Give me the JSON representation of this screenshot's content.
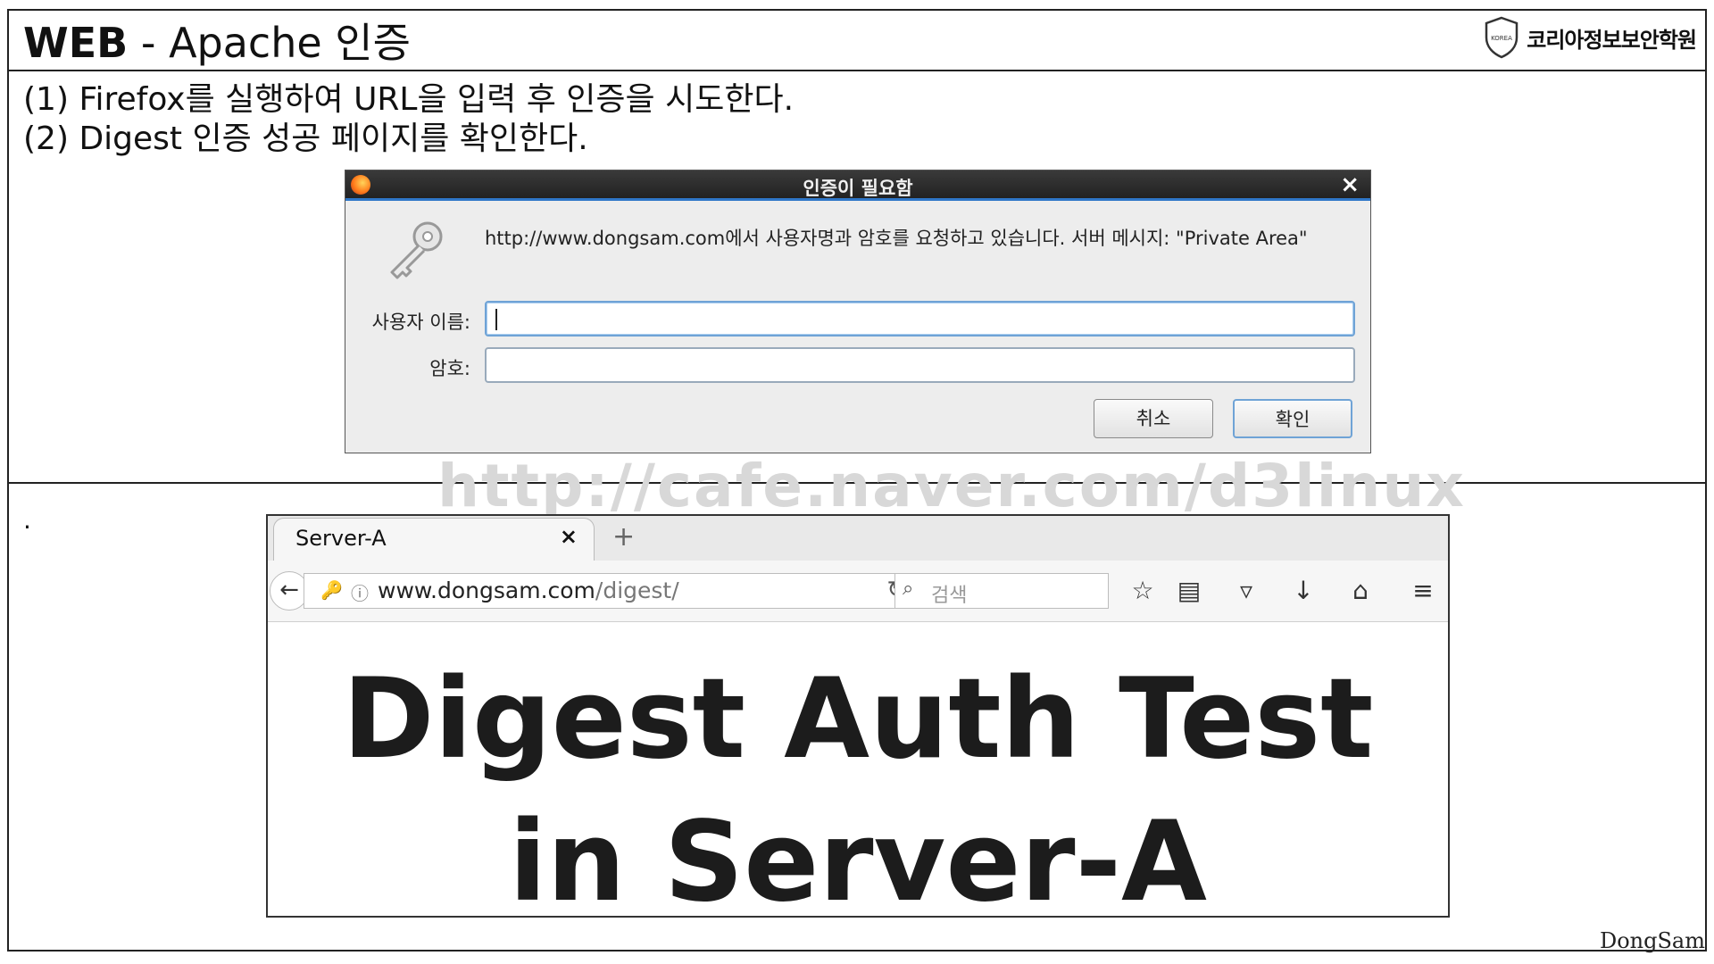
{
  "slide": {
    "title_bold": "WEB",
    "title_rest": " - Apache 인증",
    "logo_text": "코리아정보보안학원",
    "logo_badge": "KOREA",
    "steps": [
      "(1) Firefox를 실행하여 URL을 입력 후 인증을 시도한다.",
      "(2) Digest 인증 성공 페이지를 확인한다."
    ],
    "watermark": "http://cafe.naver.com/d3linux",
    "bullet_dot": ".",
    "footer": "DongSam"
  },
  "auth_dialog": {
    "title": "인증이 필요함",
    "close": "×",
    "message": "http://www.dongsam.com에서 사용자명과 암호를 요청하고 있습니다. 서버 메시지: \"Private Area\"",
    "username_label": "사용자 이름:",
    "username_value": "",
    "password_label": "암호:",
    "password_value": "",
    "cancel_label": "취소",
    "ok_label": "확인"
  },
  "browser": {
    "tab_title": "Server-A",
    "tab_close": "×",
    "new_tab": "+",
    "url_host": "www.dongsam.com",
    "url_path": "/digest/",
    "search_placeholder": "검색",
    "heading_line1": "Digest Auth Test",
    "heading_line2": "in Server-A"
  },
  "colors": {
    "dialog_accent": "#2f77c8",
    "watermark": "#d8d8d8"
  }
}
